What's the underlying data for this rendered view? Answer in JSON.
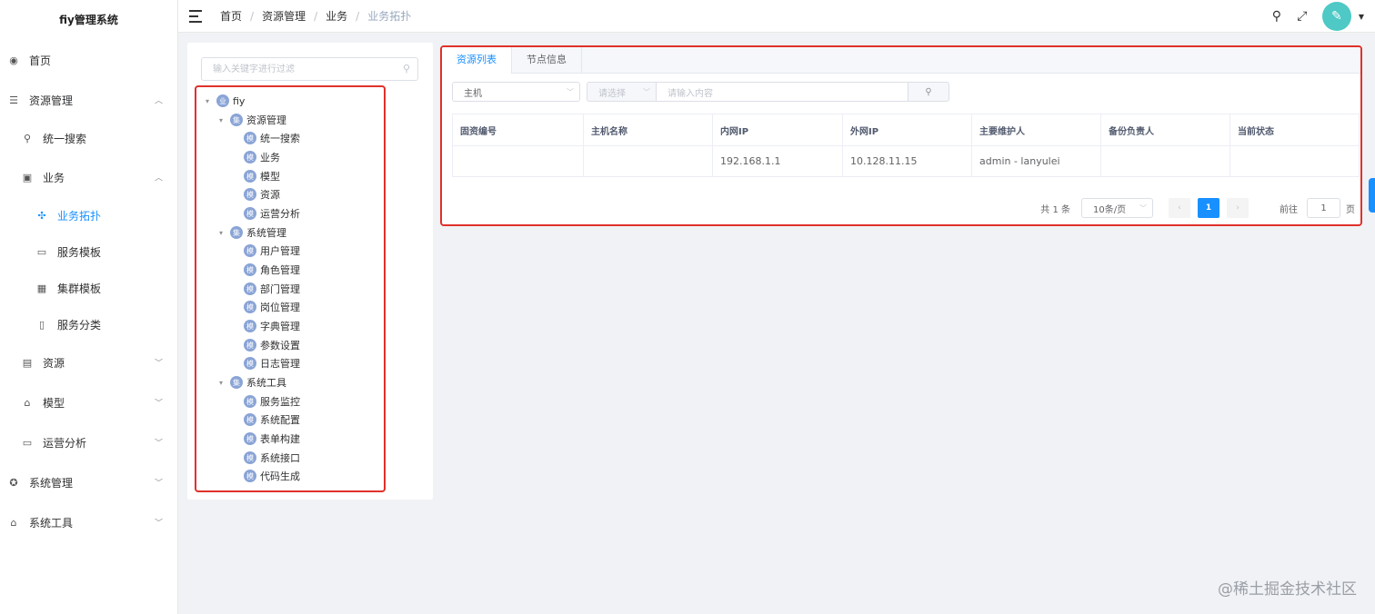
{
  "app": {
    "title": "fiy管理系统"
  },
  "sidebar": {
    "items": [
      {
        "label": "首页",
        "icon": "dashboard-icon"
      },
      {
        "label": "资源管理",
        "icon": "database-icon"
      },
      {
        "label": "统一搜索",
        "icon": "search-icon"
      },
      {
        "label": "业务",
        "icon": "business-icon"
      },
      {
        "label": "业务拓扑",
        "icon": "topology-icon"
      },
      {
        "label": "服务模板",
        "icon": "service-template-icon"
      },
      {
        "label": "集群模板",
        "icon": "cluster-template-icon"
      },
      {
        "label": "服务分类",
        "icon": "service-category-icon"
      },
      {
        "label": "资源",
        "icon": "resource-icon"
      },
      {
        "label": "模型",
        "icon": "model-icon"
      },
      {
        "label": "运营分析",
        "icon": "monitor-icon"
      },
      {
        "label": "系统管理",
        "icon": "system-settings-icon"
      },
      {
        "label": "系统工具",
        "icon": "system-tools-icon"
      }
    ]
  },
  "header": {
    "breadcrumbs": [
      "首页",
      "资源管理",
      "业务",
      "业务拓扑"
    ],
    "separator": "/"
  },
  "tree": {
    "filter_placeholder": "输入关键字进行过滤",
    "nodes": [
      {
        "badge": "业",
        "label": "fiy"
      },
      {
        "badge": "集",
        "label": "资源管理"
      },
      {
        "badge": "模",
        "label": "统一搜索"
      },
      {
        "badge": "模",
        "label": "业务"
      },
      {
        "badge": "模",
        "label": "模型"
      },
      {
        "badge": "模",
        "label": "资源"
      },
      {
        "badge": "模",
        "label": "运营分析"
      },
      {
        "badge": "集",
        "label": "系统管理"
      },
      {
        "badge": "模",
        "label": "用户管理"
      },
      {
        "badge": "模",
        "label": "角色管理"
      },
      {
        "badge": "模",
        "label": "部门管理"
      },
      {
        "badge": "模",
        "label": "岗位管理"
      },
      {
        "badge": "模",
        "label": "字典管理"
      },
      {
        "badge": "模",
        "label": "参数设置"
      },
      {
        "badge": "模",
        "label": "日志管理"
      },
      {
        "badge": "集",
        "label": "系统工具"
      },
      {
        "badge": "模",
        "label": "服务监控"
      },
      {
        "badge": "模",
        "label": "系统配置"
      },
      {
        "badge": "模",
        "label": "表单构建"
      },
      {
        "badge": "模",
        "label": "系统接口"
      },
      {
        "badge": "模",
        "label": "代码生成"
      }
    ]
  },
  "tabs": [
    "资源列表",
    "节点信息"
  ],
  "search": {
    "type_value": "主机",
    "field_placeholder": "请选择",
    "keyword_placeholder": "请输入内容"
  },
  "table": {
    "columns": [
      "固资编号",
      "主机名称",
      "内网IP",
      "外网IP",
      "主要维护人",
      "备份负责人",
      "当前状态"
    ],
    "rows": [
      [
        "",
        "",
        "192.168.1.1",
        "10.128.11.15",
        "admin - lanyulei",
        "",
        ""
      ]
    ]
  },
  "pagination": {
    "total": "共 1 条",
    "page_size": "10条/页",
    "current_page": "1",
    "goto_label": "前往",
    "goto_value": "1",
    "page_suffix": "页"
  },
  "watermark": "@稀土掘金技术社区",
  "colors": {
    "accent": "#1890ff",
    "highlight_border": "#e0312b",
    "badge": "#8aa4d6",
    "avatar": "#4ec9c5"
  }
}
